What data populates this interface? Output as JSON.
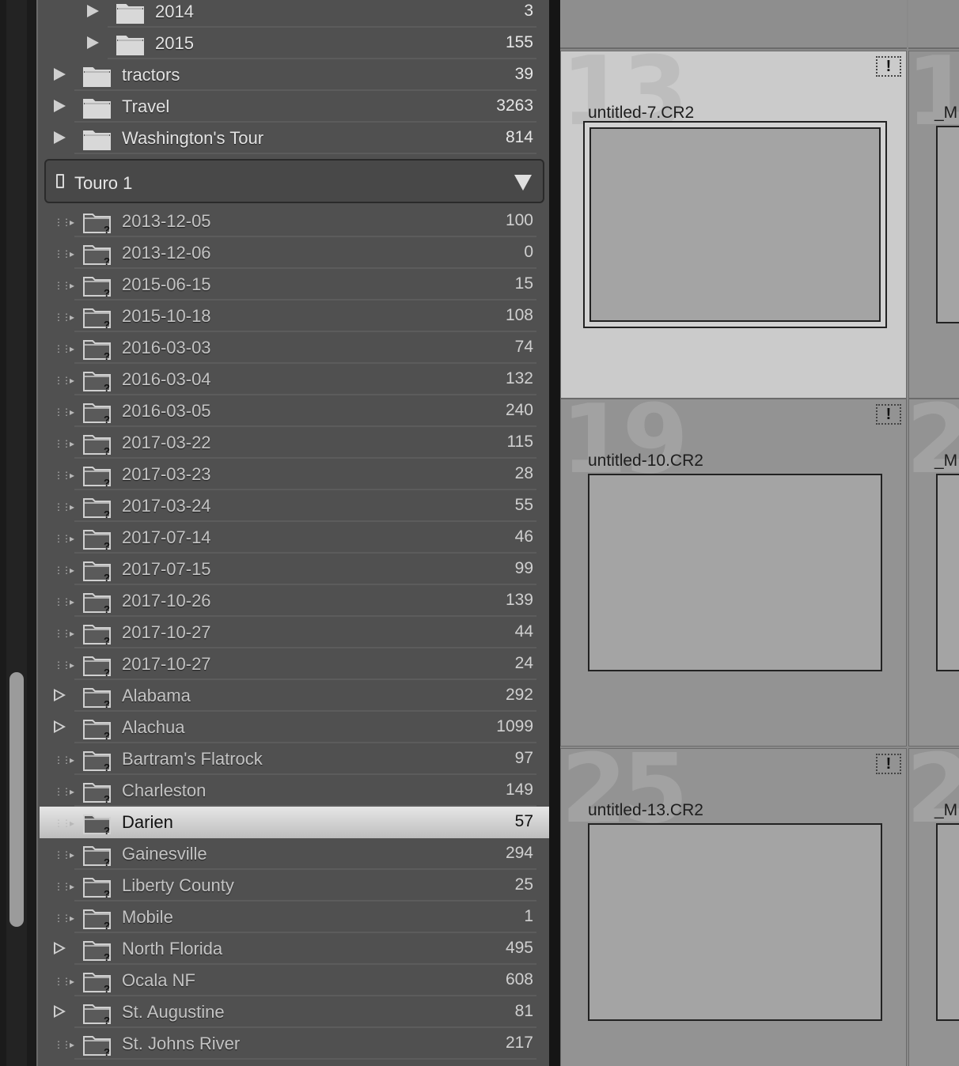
{
  "folders_top": [
    {
      "name": "2014",
      "count": "3",
      "level": 2,
      "expand": "solid"
    },
    {
      "name": "2015",
      "count": "155",
      "level": 2,
      "expand": "solid"
    },
    {
      "name": "tractors",
      "count": "39",
      "level": 1,
      "expand": "solid"
    },
    {
      "name": "Travel",
      "count": "3263",
      "level": 1,
      "expand": "solid"
    },
    {
      "name": "Washington's Tour",
      "count": "814",
      "level": 1,
      "expand": "solid"
    }
  ],
  "volume": {
    "name": "Touro 1"
  },
  "folders_volume": [
    {
      "name": "2013-12-05",
      "count": "100",
      "expand": "dots"
    },
    {
      "name": "2013-12-06",
      "count": "0",
      "expand": "dots"
    },
    {
      "name": "2015-06-15",
      "count": "15",
      "expand": "dots"
    },
    {
      "name": "2015-10-18",
      "count": "108",
      "expand": "dots"
    },
    {
      "name": "2016-03-03",
      "count": "74",
      "expand": "dots"
    },
    {
      "name": "2016-03-04",
      "count": "132",
      "expand": "dots"
    },
    {
      "name": "2016-03-05",
      "count": "240",
      "expand": "dots"
    },
    {
      "name": "2017-03-22",
      "count": "115",
      "expand": "dots"
    },
    {
      "name": "2017-03-23",
      "count": "28",
      "expand": "dots"
    },
    {
      "name": "2017-03-24",
      "count": "55",
      "expand": "dots"
    },
    {
      "name": "2017-07-14",
      "count": "46",
      "expand": "dots"
    },
    {
      "name": "2017-07-15",
      "count": "99",
      "expand": "dots"
    },
    {
      "name": "2017-10-26",
      "count": "139",
      "expand": "dots"
    },
    {
      "name": "2017-10-27",
      "count": "44",
      "expand": "dots"
    },
    {
      "name": "2017-10-27",
      "count": "24",
      "expand": "dots"
    },
    {
      "name": "Alabama",
      "count": "292",
      "expand": "solid"
    },
    {
      "name": "Alachua",
      "count": "1099",
      "expand": "solid"
    },
    {
      "name": "Bartram's Flatrock",
      "count": "97",
      "expand": "dots"
    },
    {
      "name": "Charleston",
      "count": "149",
      "expand": "dots"
    },
    {
      "name": "Darien",
      "count": "57",
      "expand": "dots",
      "selected": true
    },
    {
      "name": "Gainesville",
      "count": "294",
      "expand": "dots"
    },
    {
      "name": "Liberty County",
      "count": "25",
      "expand": "dots"
    },
    {
      "name": "Mobile",
      "count": "1",
      "expand": "dots"
    },
    {
      "name": "North Florida",
      "count": "495",
      "expand": "solid"
    },
    {
      "name": "Ocala NF",
      "count": "608",
      "expand": "dots"
    },
    {
      "name": "St. Augustine",
      "count": "81",
      "expand": "solid"
    },
    {
      "name": "St. Johns River",
      "count": "217",
      "expand": "dots"
    }
  ],
  "grid": {
    "cells": [
      {
        "index": "13",
        "filename": "untitled-7.CR2",
        "selected": true,
        "badge": "!"
      },
      {
        "index": "19",
        "filename": "untitled-10.CR2",
        "selected": false,
        "badge": "!"
      },
      {
        "index": "25",
        "filename": "untitled-13.CR2",
        "selected": false,
        "badge": "!"
      }
    ],
    "partial_cells": [
      {
        "index": "1",
        "filename": "_M"
      },
      {
        "index": "2",
        "filename": "_M"
      },
      {
        "index": "2",
        "filename": "_M"
      }
    ]
  },
  "colors": {
    "panel": "#505050",
    "selected_row": "#d4d4d4",
    "grid_bg": "#939393",
    "selected_cell": "#cbcbcb"
  }
}
